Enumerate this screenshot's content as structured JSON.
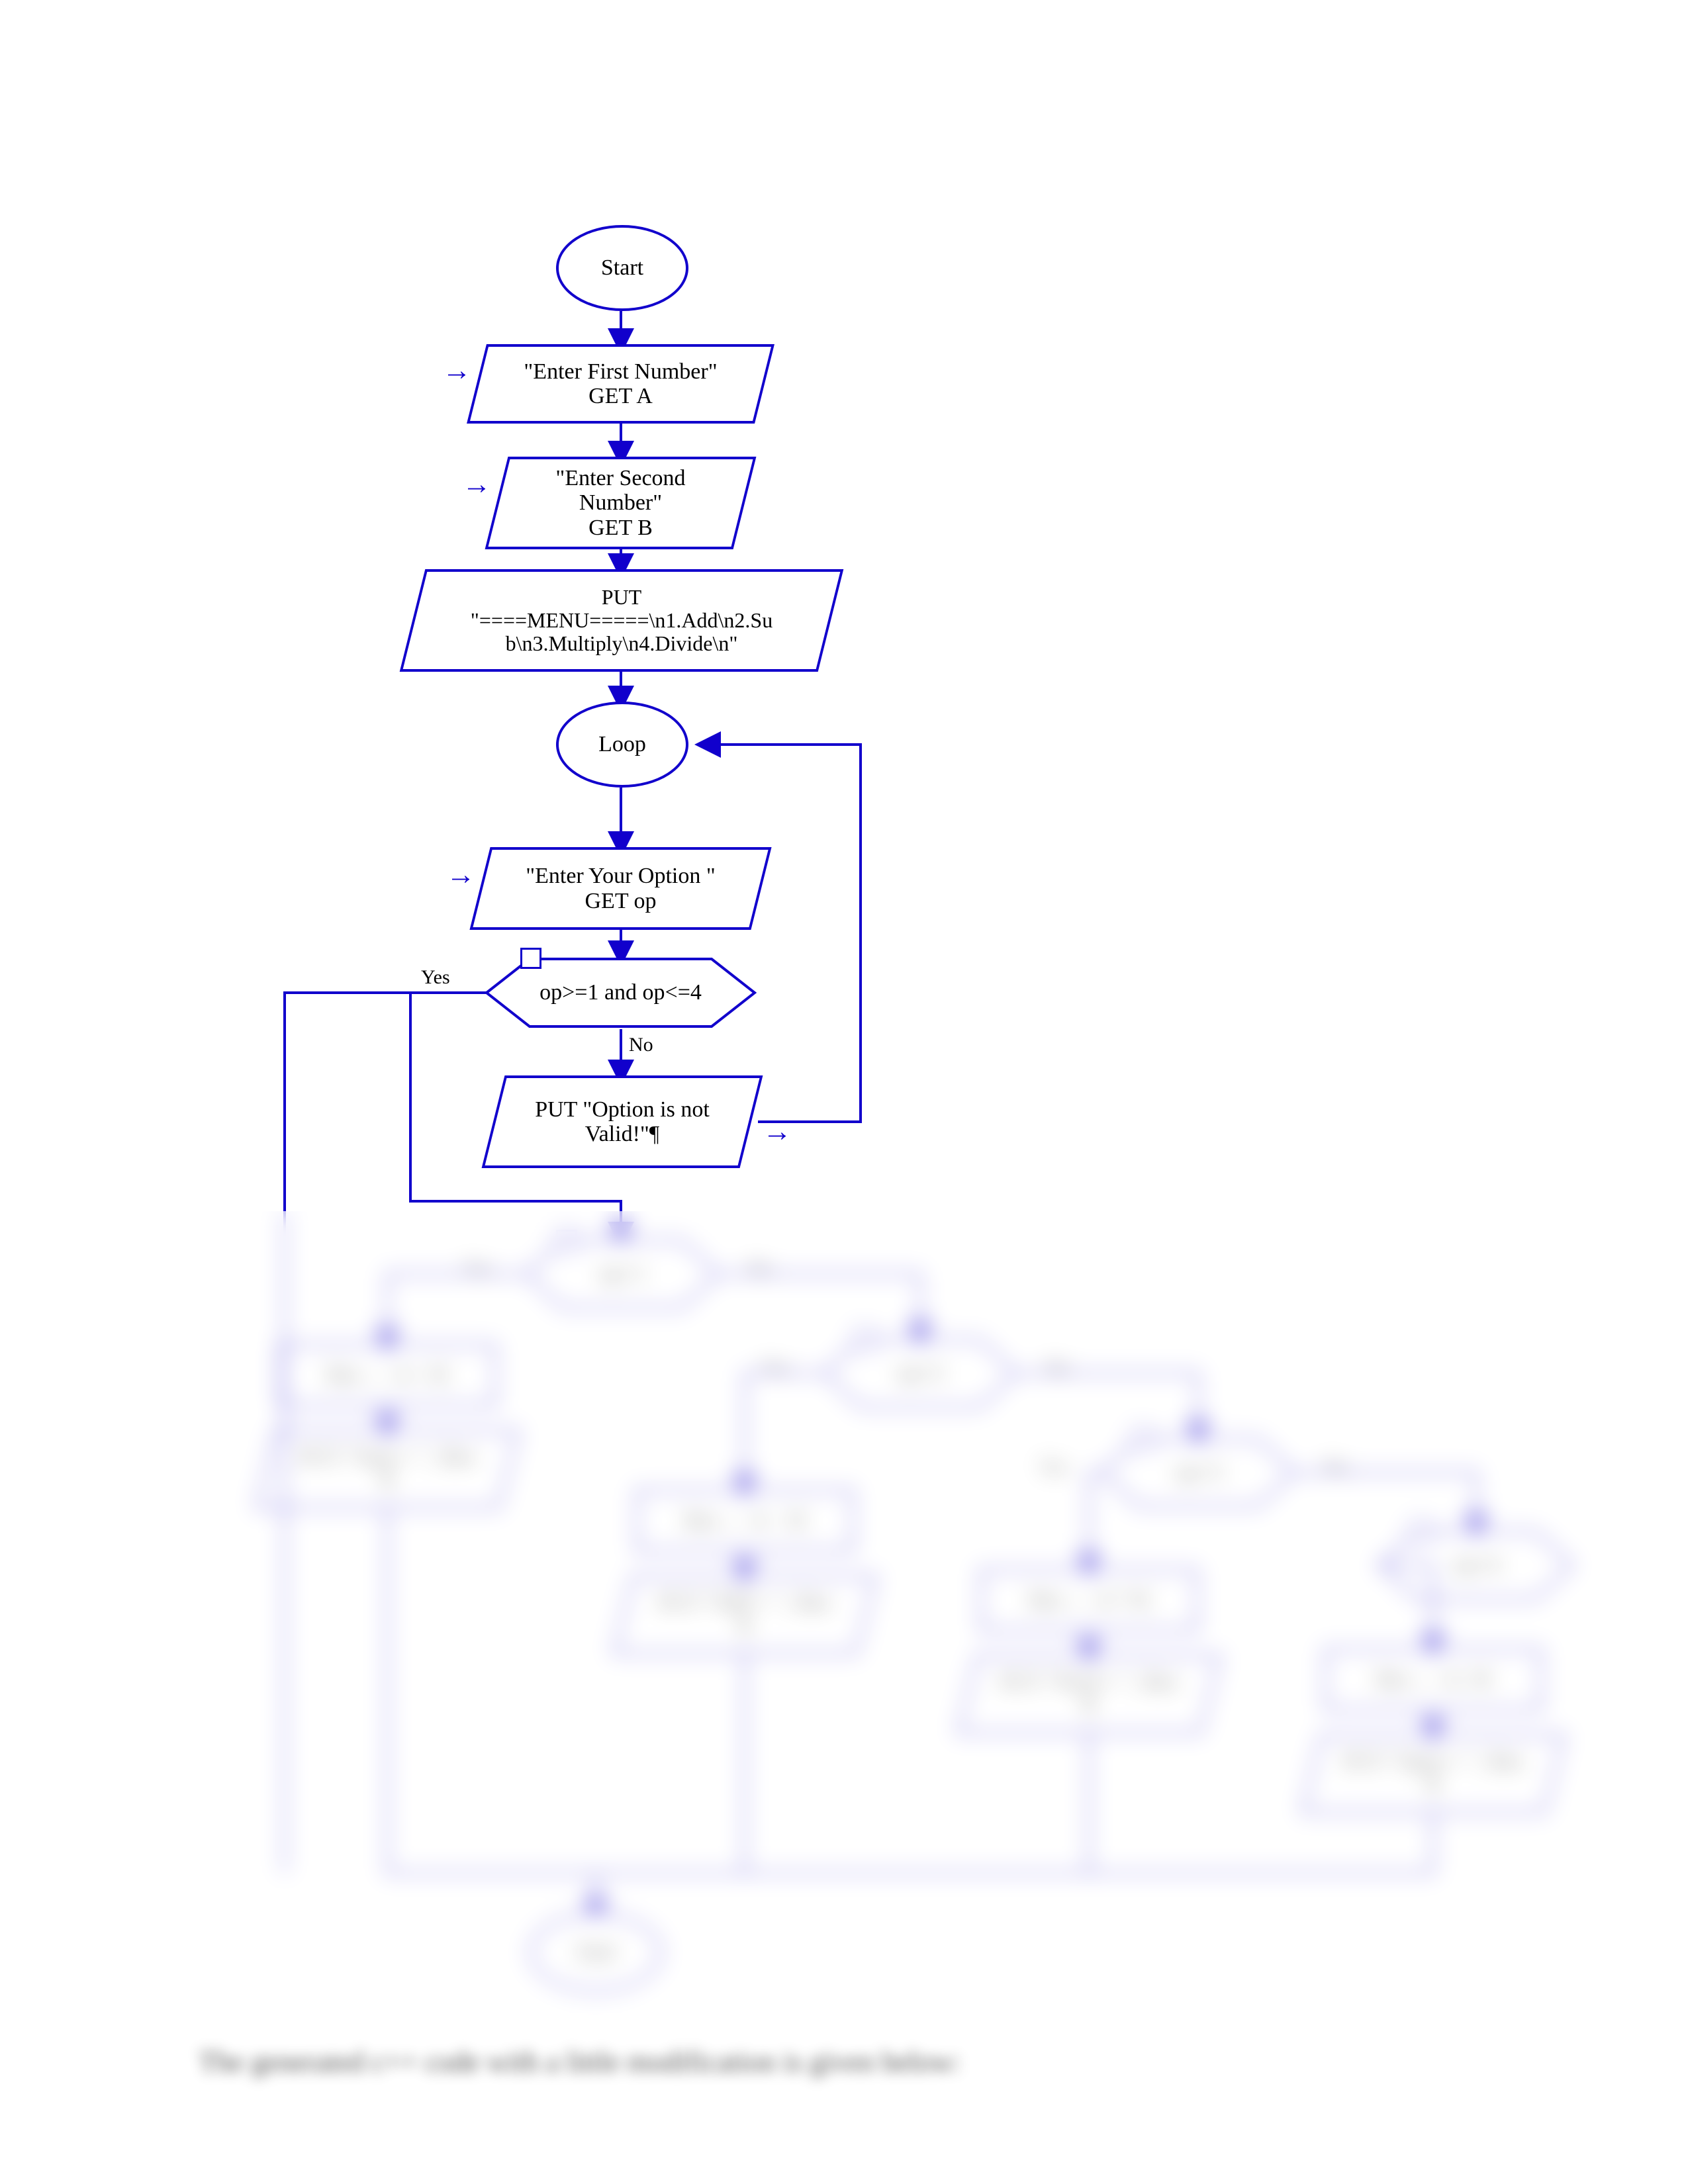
{
  "diagram": {
    "start_label": "Start",
    "loop_label": "Loop",
    "end_label": "End",
    "input_a_line1": "\"Enter First Number\"",
    "input_a_line2": "GET A",
    "input_b_line1": "\"Enter Second",
    "input_b_line2": "Number\"",
    "input_b_line3": "GET B",
    "menu_line1": "PUT",
    "menu_line2": "\"====MENU=====\\n1.Add\\n2.Su",
    "menu_line3": "b\\n3.Multiply\\n4.Divide\\n\"",
    "opt_line1": "\"Enter Your Option \"",
    "opt_line2": "GET op",
    "validate_cond": "op>=1 and op<=4",
    "validate_yes": "Yes",
    "validate_no": "No",
    "invalid_line1": "PUT \"Option is not",
    "invalid_line2": "Valid!\"¶",
    "branches": [
      {
        "cond": "op=1",
        "proc": "Res ← A + B",
        "out_line1": "PUT \"Sum = \", Res",
        "out_line2": "¶"
      },
      {
        "cond": "op=2",
        "proc": "Res ← A − B",
        "out_line1": "PUT \"Diff = \", Res",
        "out_line2": "¶"
      },
      {
        "cond": "op=3",
        "proc": "Res ← A * B",
        "out_line1": "PUT \"Prod = \", Res",
        "out_line2": "¶"
      },
      {
        "cond": "op=4",
        "proc": "Res ← A / B",
        "out_line1": "PUT \"Quot = \", Res",
        "out_line2": "¶"
      }
    ],
    "branch_yes": "Yes",
    "branch_no": "No"
  },
  "caption_text": "The generated c++ code with a little modification is given below:"
}
